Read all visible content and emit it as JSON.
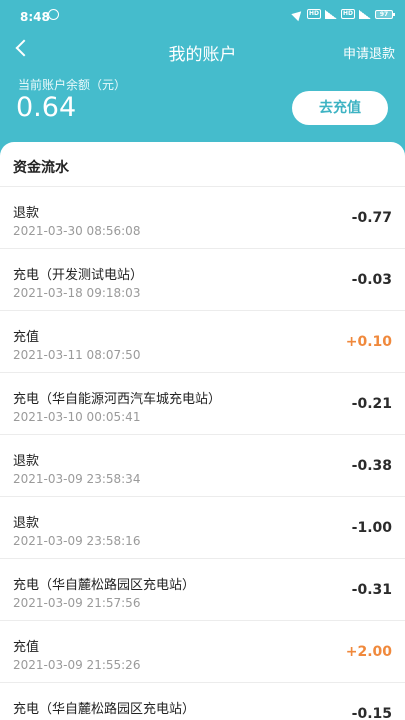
{
  "status_bar": {
    "time": "8:48",
    "battery": "97"
  },
  "header": {
    "title": "我的账户",
    "refund_link": "申请退款",
    "balance_label": "当前账户余额（元）",
    "balance_value": "0.64",
    "recharge_button": "去充值"
  },
  "flow": {
    "title": "资金流水",
    "rows": [
      {
        "name": "退款",
        "time": "2021-03-30 08:56:08",
        "amount": "-0.77",
        "positive": false
      },
      {
        "name": "充电（开发测试电站）",
        "time": "2021-03-18 09:18:03",
        "amount": "-0.03",
        "positive": false
      },
      {
        "name": "充值",
        "time": "2021-03-11 08:07:50",
        "amount": "+0.10",
        "positive": true
      },
      {
        "name": "充电（华自能源河西汽车城充电站）",
        "time": "2021-03-10 00:05:41",
        "amount": "-0.21",
        "positive": false
      },
      {
        "name": "退款",
        "time": "2021-03-09 23:58:34",
        "amount": "-0.38",
        "positive": false
      },
      {
        "name": "退款",
        "time": "2021-03-09 23:58:16",
        "amount": "-1.00",
        "positive": false
      },
      {
        "name": "充电（华自麓松路园区充电站）",
        "time": "2021-03-09 21:57:56",
        "amount": "-0.31",
        "positive": false
      },
      {
        "name": "充值",
        "time": "2021-03-09 21:55:26",
        "amount": "+2.00",
        "positive": true
      },
      {
        "name": "充电（华自麓松路园区充电站）",
        "time": "",
        "amount": "-0.15",
        "positive": false
      }
    ]
  },
  "colors": {
    "header_bg": "#45bccc",
    "positive_amount": "#f0893c",
    "negative_amount": "#2b2b2b"
  }
}
